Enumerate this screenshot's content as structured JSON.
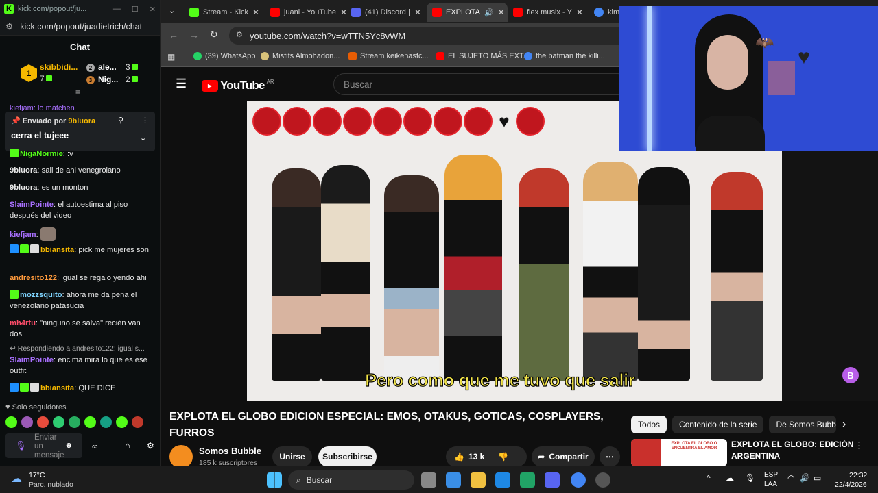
{
  "kick": {
    "window_url_short": "kick.com/popout/ju...",
    "address": "kick.com/popout/juadietrich/chat",
    "chat_title": "Chat",
    "gifters": [
      {
        "rank": "1",
        "name": "skibbidi...",
        "count": "7"
      },
      {
        "rank": "2",
        "name": "ale...",
        "count": "3"
      },
      {
        "rank": "3",
        "name": "Nig...",
        "count": "2"
      }
    ],
    "partial_top_line": "kiefjam: lo matchen",
    "pinned": {
      "header": "Enviado por",
      "by": "9bluora",
      "message": "cerra el tujeee"
    },
    "messages": [
      {
        "user": "NigaNormie",
        "text": ": :v",
        "color": "#53fc18"
      },
      {
        "user": "9bluora",
        "text": ": sali de ahi venegrolano",
        "color": "#ffffff"
      },
      {
        "user": "9bluora",
        "text": ": es un monton",
        "color": "#ffffff"
      },
      {
        "user": "SlaimPointe",
        "text": ": el autoestima al piso después del video",
        "color": "#a970ff"
      },
      {
        "user": "kiefjam",
        "text": ":",
        "color": "#a970ff"
      },
      {
        "user": "bbiansita",
        "text": ": pick me mujeres son",
        "color": "#f5b800"
      },
      {
        "user": "andresito122",
        "text": ": igual se regalo yendo ahi",
        "color": "#ff9a3c"
      },
      {
        "user": "mozzsquito",
        "text": ": ahora me da pena el venezolano patasucia",
        "color": "#7fd4ff"
      },
      {
        "user": "mh4rtu",
        "text": ": \"ninguno se salva\" recién van dos",
        "color": "#ff4d6a"
      },
      {
        "user": "SlaimPointe",
        "text": ": encima mira lo que es ese outfit",
        "color": "#a970ff"
      },
      {
        "user": "bbiansita",
        "text": ": QUE DICE",
        "color": "#f5b800"
      }
    ],
    "reply_hint": "Respondiendo a andresito122: igual s...",
    "followers_label": "Solo seguidores",
    "input_placeholder": "Enviar un mensaje"
  },
  "browser": {
    "tabs": [
      {
        "label": "Stream - Kick",
        "color": "#53fc18"
      },
      {
        "label": "juani - YouTube",
        "color": "#ff0000"
      },
      {
        "label": "(41) Discord |",
        "color": "#5865f2"
      },
      {
        "label": "EXPLOTA",
        "color": "#ff0000"
      },
      {
        "label": "flex musix - Y",
        "color": "#ff0000"
      },
      {
        "label": "kim",
        "color": "#4285f4"
      }
    ],
    "url": "youtube.com/watch?v=wTTN5Yc8vWM",
    "bookmarks": [
      "(39) WhatsApp",
      "Misfits Almohadon...",
      "Stream keikenasfc...",
      "EL SUJETO MÁS EXT...",
      "the batman the killi..."
    ]
  },
  "youtube": {
    "logo": "YouTube",
    "region": "AR",
    "search_placeholder": "Buscar",
    "subtitle": "Pero como que me tuvo que salir",
    "title": "EXPLOTA EL GLOBO EDICION ESPECIAL: EMOS, OTAKUS, GOTICAS, COSPLAYERS, FURROS",
    "channel": "Somos Bubble",
    "subscribers": "185 k suscriptores",
    "join_label": "Unirse",
    "subscribe_label": "Subscribirse",
    "likes": "13 k",
    "share_label": "Compartir",
    "chips": [
      "Todos",
      "Contenido de la serie",
      "De Somos Bubble"
    ],
    "rec_title": "EXPLOTA EL GLOBO: EDICIÓN ARGENTINA",
    "rec_thumb_text": "EXPLOTA EL GLOBO O ENCUENTRA EL AMOR"
  },
  "taskbar": {
    "temp": "17°C",
    "weather": "Parc. nublado",
    "search": "Buscar",
    "lang": "ESP",
    "lang2": "LAA",
    "time": "22:32",
    "date": "22/4/2026"
  }
}
